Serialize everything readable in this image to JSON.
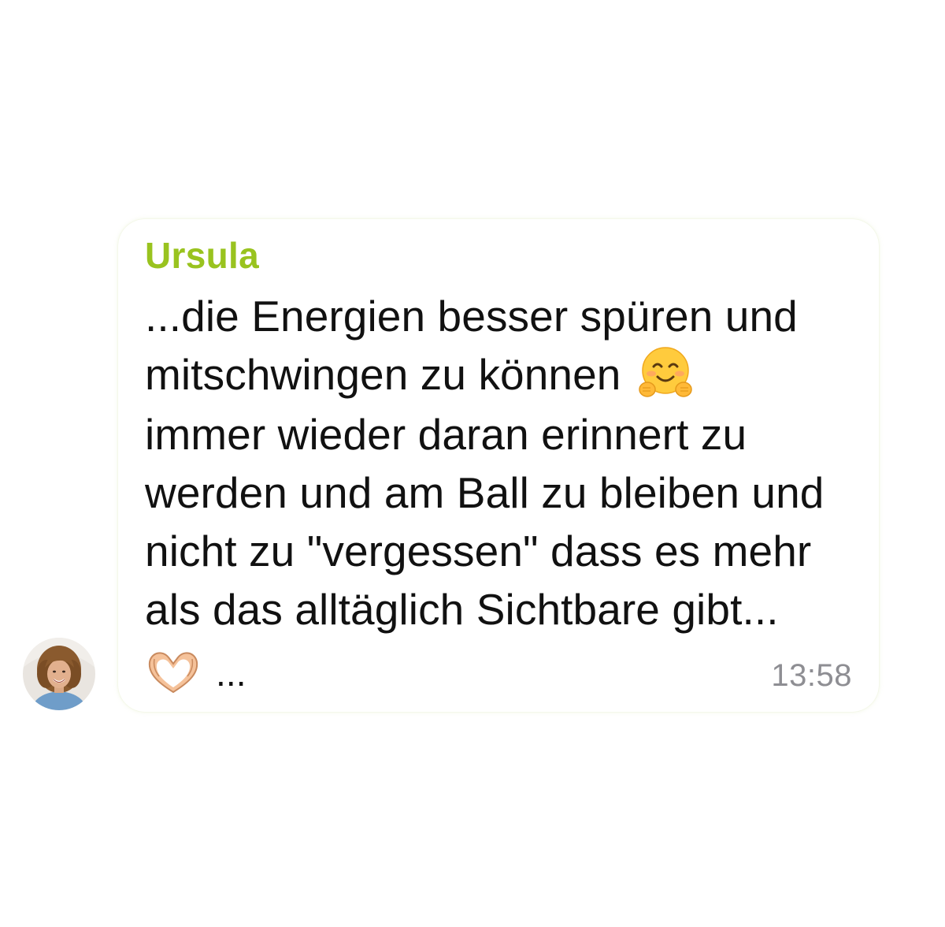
{
  "message": {
    "sender": "Ursula",
    "lines": [
      "...die Energien besser spüren und",
      "mitschwingen zu können",
      "immer wieder daran erinnert zu",
      "werden und am Ball zu bleiben und",
      "nicht zu \"vergessen\" dass es mehr",
      "als das alltäglich Sichtbare gibt..."
    ],
    "trailing_text": "...",
    "time": "13:58",
    "emojis": [
      "hugging-face-emoji",
      "heart-hands-emoji"
    ],
    "colors": {
      "sender": "#99c31f",
      "text": "#111111",
      "time": "#8e8e93",
      "bubble": "#ffffff"
    }
  },
  "avatar": {
    "icon": "user-avatar-photo"
  }
}
